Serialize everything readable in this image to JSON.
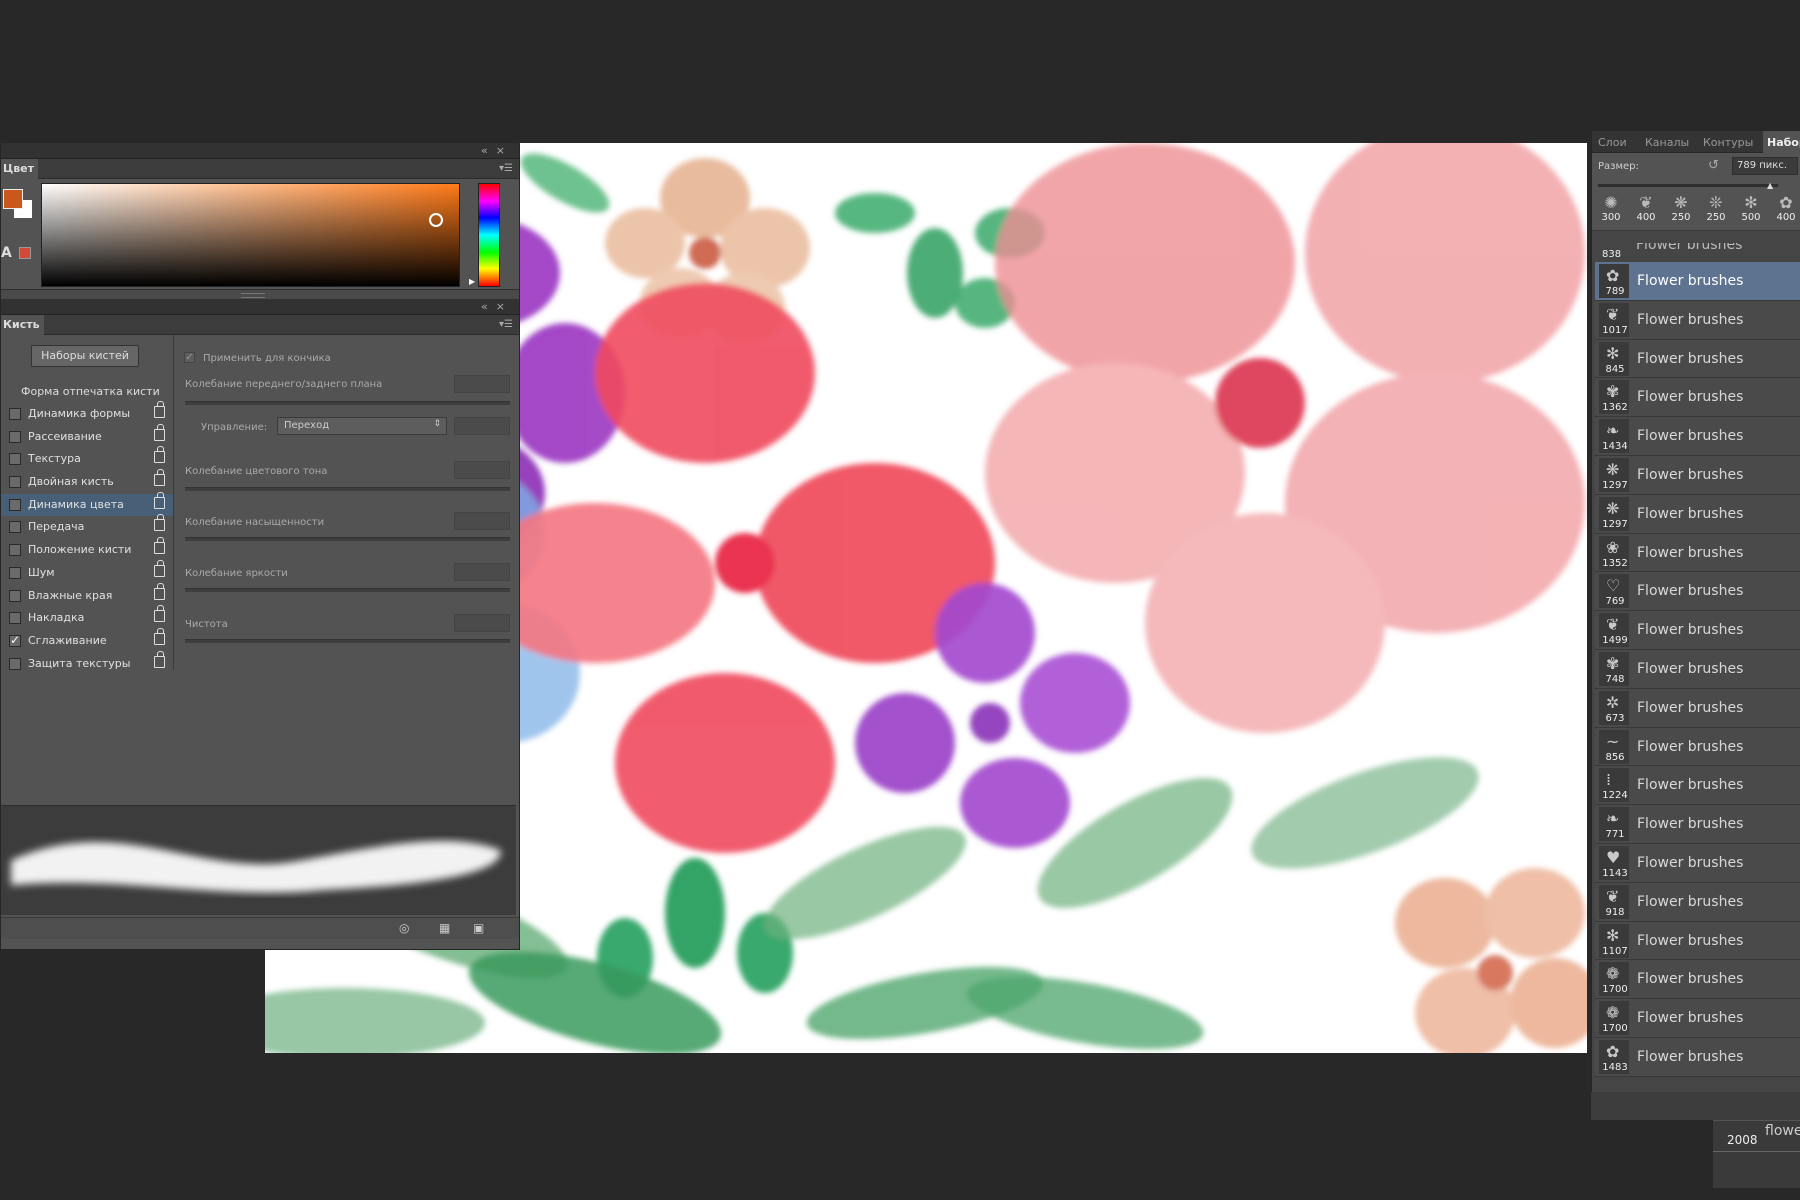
{
  "color_panel": {
    "title": "Цвет",
    "foreground": "#c8581c",
    "background": "#ffffff"
  },
  "brush_panel": {
    "title": "Кисть",
    "presets_button": "Наборы кистей",
    "tip_shape_title": "Форма отпечатка кисти",
    "options": [
      {
        "label": "Динамика формы",
        "checked": false,
        "selected": false
      },
      {
        "label": "Рассеивание",
        "checked": false,
        "selected": false
      },
      {
        "label": "Текстура",
        "checked": false,
        "selected": false
      },
      {
        "label": "Двойная кисть",
        "checked": false,
        "selected": false
      },
      {
        "label": "Динамика цвета",
        "checked": false,
        "selected": true
      },
      {
        "label": "Передача",
        "checked": false,
        "selected": false
      },
      {
        "label": "Положение кисти",
        "checked": false,
        "selected": false
      },
      {
        "label": "Шум",
        "checked": false,
        "selected": false
      },
      {
        "label": "Влажные края",
        "checked": false,
        "selected": false
      },
      {
        "label": "Накладка",
        "checked": false,
        "selected": false
      },
      {
        "label": "Сглаживание",
        "checked": true,
        "selected": false
      },
      {
        "label": "Защита текстуры",
        "checked": false,
        "selected": false
      }
    ],
    "apply_per_tip": "Применить для кончика",
    "fg_bg_jitter": "Колебание переднего/заднего плана",
    "control_label": "Управление:",
    "control_value": "Переход",
    "hue_jitter": "Колебание цветового тона",
    "saturation_jitter": "Колебание насыщенности",
    "brightness_jitter": "Колебание яркости",
    "purity": "Чистота"
  },
  "right_panel": {
    "tabs": [
      "Слои",
      "Каналы",
      "Контуры",
      "Набор"
    ],
    "size_label": "Размер:",
    "size_value": "789 пикс.",
    "presets": [
      {
        "icon": "✺",
        "size": "300"
      },
      {
        "icon": "❦",
        "size": "400"
      },
      {
        "icon": "❋",
        "size": "250"
      },
      {
        "icon": "❊",
        "size": "250"
      },
      {
        "icon": "✻",
        "size": "500"
      },
      {
        "icon": "✿",
        "size": "400"
      }
    ],
    "partial_item": {
      "size": "838",
      "name": "Flower brushes"
    },
    "brushes": [
      {
        "icon": "✿",
        "size": "789",
        "name": "Flower brushes",
        "selected": true
      },
      {
        "icon": "❦",
        "size": "1017",
        "name": "Flower brushes",
        "selected": false
      },
      {
        "icon": "✻",
        "size": "845",
        "name": "Flower brushes",
        "selected": false
      },
      {
        "icon": "✾",
        "size": "1362",
        "name": "Flower brushes",
        "selected": false
      },
      {
        "icon": "❧",
        "size": "1434",
        "name": "Flower brushes",
        "selected": false
      },
      {
        "icon": "❋",
        "size": "1297",
        "name": "Flower brushes",
        "selected": false
      },
      {
        "icon": "❋",
        "size": "1297",
        "name": "Flower brushes",
        "selected": false
      },
      {
        "icon": "❀",
        "size": "1352",
        "name": "Flower brushes",
        "selected": false
      },
      {
        "icon": "♡",
        "size": "769",
        "name": "Flower brushes",
        "selected": false
      },
      {
        "icon": "❦",
        "size": "1499",
        "name": "Flower brushes",
        "selected": false
      },
      {
        "icon": "✾",
        "size": "748",
        "name": "Flower brushes",
        "selected": false
      },
      {
        "icon": "✲",
        "size": "673",
        "name": "Flower brushes",
        "selected": false
      },
      {
        "icon": "~",
        "size": "856",
        "name": "Flower brushes",
        "selected": false
      },
      {
        "icon": "⁞",
        "size": "1224",
        "name": "Flower brushes",
        "selected": false
      },
      {
        "icon": "❧",
        "size": "771",
        "name": "Flower brushes",
        "selected": false
      },
      {
        "icon": "♥",
        "size": "1143",
        "name": "Flower brushes",
        "selected": false
      },
      {
        "icon": "❦",
        "size": "918",
        "name": "Flower brushes",
        "selected": false
      },
      {
        "icon": "✻",
        "size": "1107",
        "name": "Flower brushes",
        "selected": false
      },
      {
        "icon": "❁",
        "size": "1700",
        "name": "Flower brushes",
        "selected": false
      },
      {
        "icon": "❁",
        "size": "1700",
        "name": "Flower brushes",
        "selected": false
      },
      {
        "icon": "✿",
        "size": "1483",
        "name": "Flower brushes",
        "selected": false
      }
    ],
    "stray_item": {
      "size": "2008",
      "name": "flowe"
    }
  }
}
